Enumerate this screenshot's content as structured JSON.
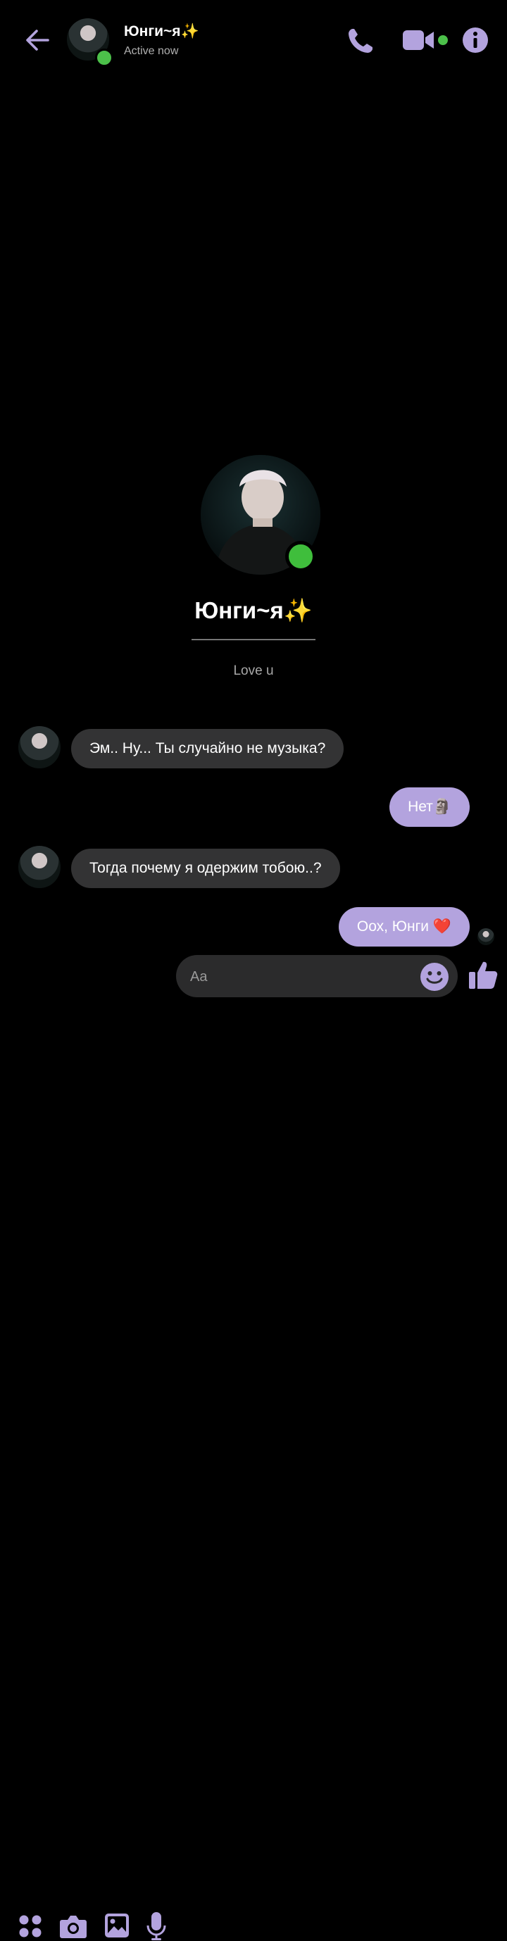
{
  "header": {
    "contact_name": "Юнги~я✨",
    "status": "Active now",
    "icons": [
      "back-arrow-icon",
      "phone-icon",
      "video-camera-icon",
      "info-icon"
    ]
  },
  "profile": {
    "name": "Юнги~я✨",
    "divider": "————————",
    "bio": "Love u"
  },
  "messages": [
    {
      "from": "contact",
      "text": "Эм.. Ну... Ты случайно не музыка?"
    },
    {
      "from": "me",
      "text": "Нет🗿"
    },
    {
      "from": "contact",
      "text": "Тогда почему я одержим тобою..?"
    },
    {
      "from": "me",
      "text": "Оох, Юнги ❤️"
    }
  ],
  "composer": {
    "placeholder": "Aa",
    "icons": [
      "apps-icon",
      "camera-icon",
      "gallery-icon",
      "microphone-icon",
      "emoji-icon",
      "thumbs-up-icon"
    ]
  },
  "colors": {
    "accent": "#b3a3de",
    "background": "#000000",
    "incoming_bubble": "#333334",
    "online": "#4cc04a"
  }
}
